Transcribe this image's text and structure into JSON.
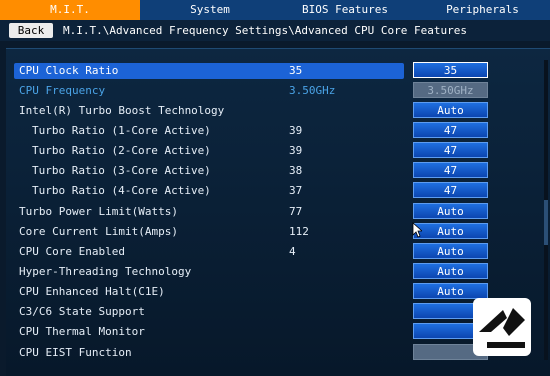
{
  "tabs": [
    "M.I.T.",
    "System",
    "BIOS Features",
    "Peripherals"
  ],
  "nav": {
    "back_label": "Back",
    "path": "M.I.T.\\Advanced Frequency Settings\\Advanced CPU Core Features"
  },
  "rows": [
    {
      "name": "CPU Clock Ratio",
      "current": "35",
      "value": "35"
    },
    {
      "name": "CPU Frequency",
      "current": "3.50GHz",
      "value": "3.50GHz"
    },
    {
      "name": "Intel(R) Turbo Boost Technology",
      "current": "",
      "value": "Auto"
    },
    {
      "name": "Turbo Ratio (1-Core Active)",
      "current": "39",
      "value": "47"
    },
    {
      "name": "Turbo Ratio (2-Core Active)",
      "current": "39",
      "value": "47"
    },
    {
      "name": "Turbo Ratio (3-Core Active)",
      "current": "38",
      "value": "47"
    },
    {
      "name": "Turbo Ratio (4-Core Active)",
      "current": "37",
      "value": "47"
    },
    {
      "name": "Turbo Power Limit(Watts)",
      "current": "77",
      "value": "Auto"
    },
    {
      "name": "Core Current Limit(Amps)",
      "current": "112",
      "value": "Auto"
    },
    {
      "name": "CPU Core Enabled",
      "current": "4",
      "value": "Auto"
    },
    {
      "name": "Hyper-Threading Technology",
      "current": "",
      "value": "Auto"
    },
    {
      "name": "CPU Enhanced Halt(C1E)",
      "current": "",
      "value": "Auto"
    },
    {
      "name": "C3/C6 State Support",
      "current": "",
      "value": ""
    },
    {
      "name": "CPU Thermal Monitor",
      "current": "",
      "value": ""
    },
    {
      "name": "CPU EIST Function",
      "current": "",
      "value": ""
    }
  ],
  "colors": {
    "active_tab": "#ff8d00",
    "selection": "#1c63d6",
    "value_button": "#1f6fe0",
    "dim_text": "#4aa3e6"
  },
  "icons": [
    "cursor-icon",
    "watermark-logo-icon"
  ]
}
